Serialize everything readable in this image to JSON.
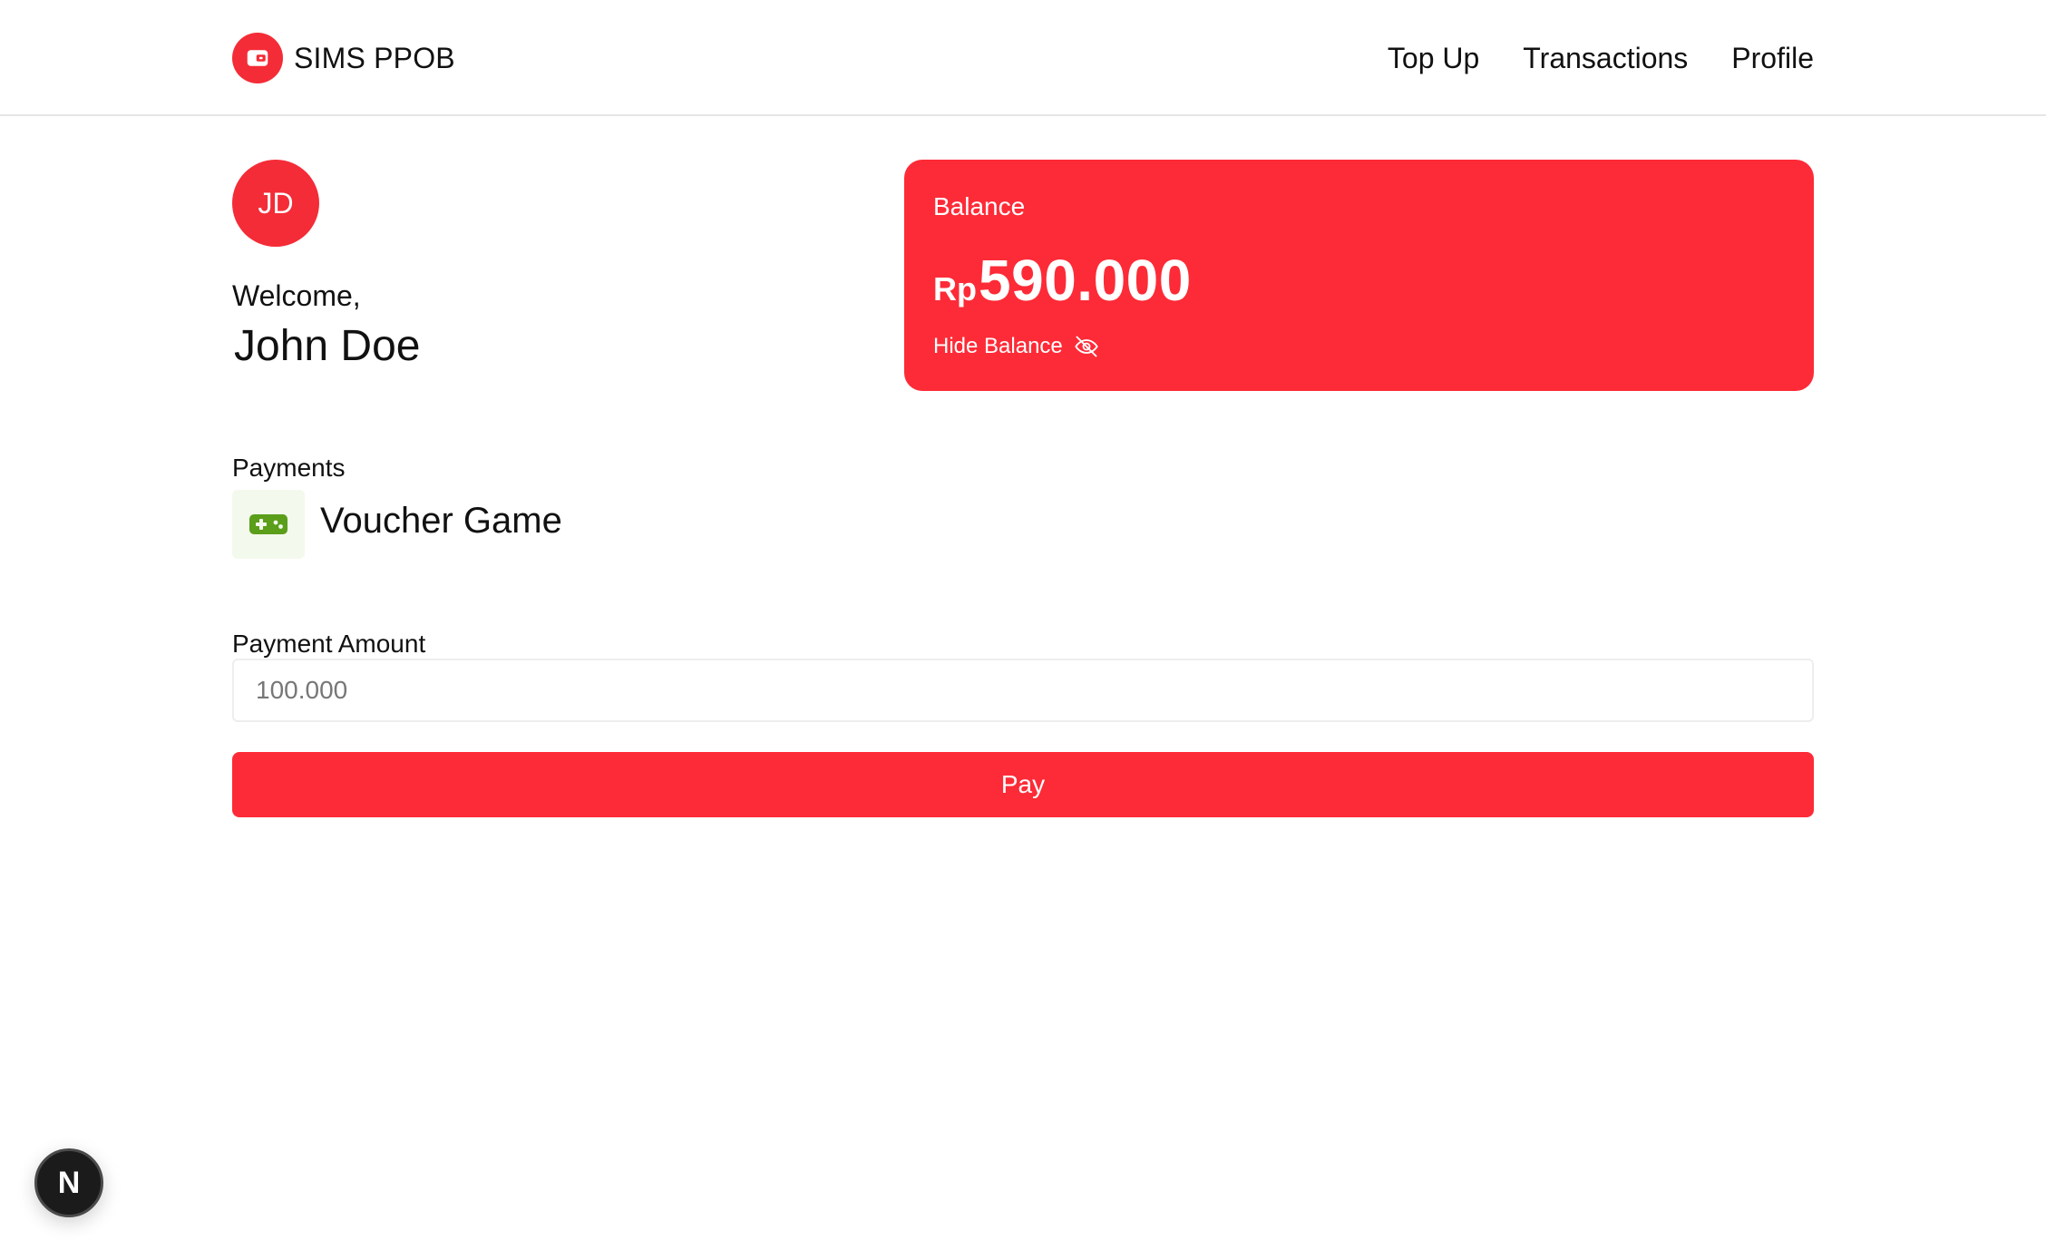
{
  "app": {
    "brand_name": "SIMS PPOB",
    "accent_color": "#fd2b37"
  },
  "nav": {
    "items": [
      {
        "label": "Top Up"
      },
      {
        "label": "Transactions"
      },
      {
        "label": "Profile"
      }
    ]
  },
  "user": {
    "initials": "JD",
    "welcome_text": "Welcome,",
    "name": "John Doe"
  },
  "balance": {
    "label": "Balance",
    "currency": "Rp",
    "amount": "590.000",
    "hide_label": "Hide Balance",
    "hide_icon": "eye-off-icon"
  },
  "payment": {
    "section_label": "Payments",
    "service_name": "Voucher Game",
    "service_icon": "game-controller-icon",
    "service_icon_color": "#5a9e1a",
    "amount_label": "Payment Amount",
    "amount_value": "100.000",
    "pay_label": "Pay"
  },
  "dev_badge": {
    "label": "N"
  }
}
